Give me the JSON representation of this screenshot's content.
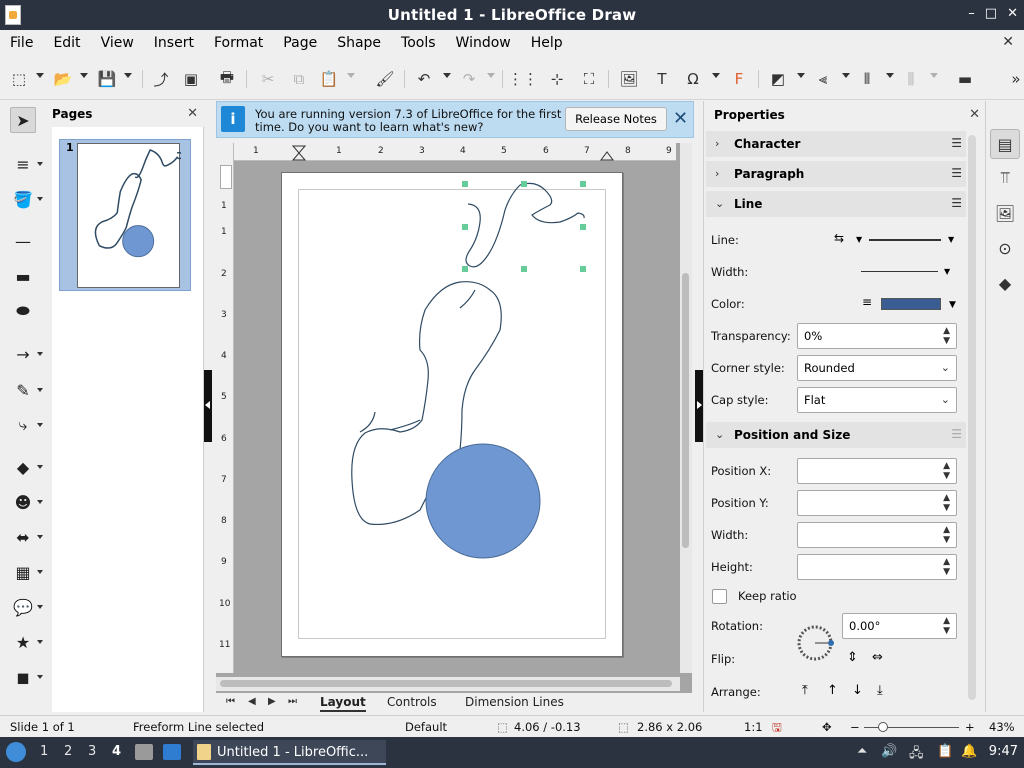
{
  "window": {
    "title": "Untitled 1 - LibreOffice Draw",
    "minimize": "–",
    "maximize": "□",
    "close": "✕"
  },
  "menu": {
    "items": [
      "File",
      "Edit",
      "View",
      "Insert",
      "Format",
      "Page",
      "Shape",
      "Tools",
      "Window",
      "Help"
    ],
    "close": "✕"
  },
  "pages_panel": {
    "title": "Pages",
    "close": "✕",
    "page_number": "1"
  },
  "infobar": {
    "icon": "i",
    "message": "You are running version 7.3 of LibreOffice for the first time. Do you want to learn what's new?",
    "release_button": "Release Notes",
    "close": "✕"
  },
  "ruler": {
    "h_numbers": [
      "1",
      "1",
      "2",
      "3",
      "4",
      "5",
      "6",
      "7",
      "8",
      "9"
    ],
    "v_numbers": [
      "1",
      "1",
      "2",
      "3",
      "4",
      "5",
      "6",
      "7",
      "8",
      "9",
      "10",
      "11"
    ]
  },
  "drawing": {
    "circle_fill": "#6f98d3",
    "circle_stroke": "#4a6a98",
    "line_color": "#2f4b63",
    "handle_color": "#66cc99"
  },
  "tabs": {
    "items": [
      "Layout",
      "Controls",
      "Dimension Lines"
    ],
    "active": "Layout"
  },
  "properties": {
    "title": "Properties",
    "close": "✕",
    "sections": {
      "character": "Character",
      "paragraph": "Paragraph",
      "line": "Line",
      "position_size": "Position and Size"
    },
    "line": {
      "line_label": "Line:",
      "width_label": "Width:",
      "color_label": "Color:",
      "color_value": "#3a5e94",
      "transparency_label": "Transparency:",
      "transparency_value": "0%",
      "corner_label": "Corner style:",
      "corner_value": "Rounded",
      "cap_label": "Cap style:",
      "cap_value": "Flat"
    },
    "position": {
      "pos_x_label": "Position X:",
      "pos_y_label": "Position Y:",
      "width_label": "Width:",
      "height_label": "Height:",
      "keep_ratio_label": "Keep ratio",
      "rotation_label": "Rotation:",
      "rotation_value": "0.00°",
      "flip_label": "Flip:",
      "arrange_label": "Arrange:"
    }
  },
  "status": {
    "slide": "Slide 1 of 1",
    "selection": "Freeform Line selected",
    "layout": "Default",
    "position": "4.06 / -0.13",
    "size": "2.86 x 2.06",
    "scale": "1:1",
    "zoom": "43%"
  },
  "taskbar": {
    "workspaces": [
      "1",
      "2",
      "3",
      "4"
    ],
    "active_workspace": "4",
    "task_title": "Untitled 1 - LibreOffic...",
    "clock": "9:47"
  }
}
